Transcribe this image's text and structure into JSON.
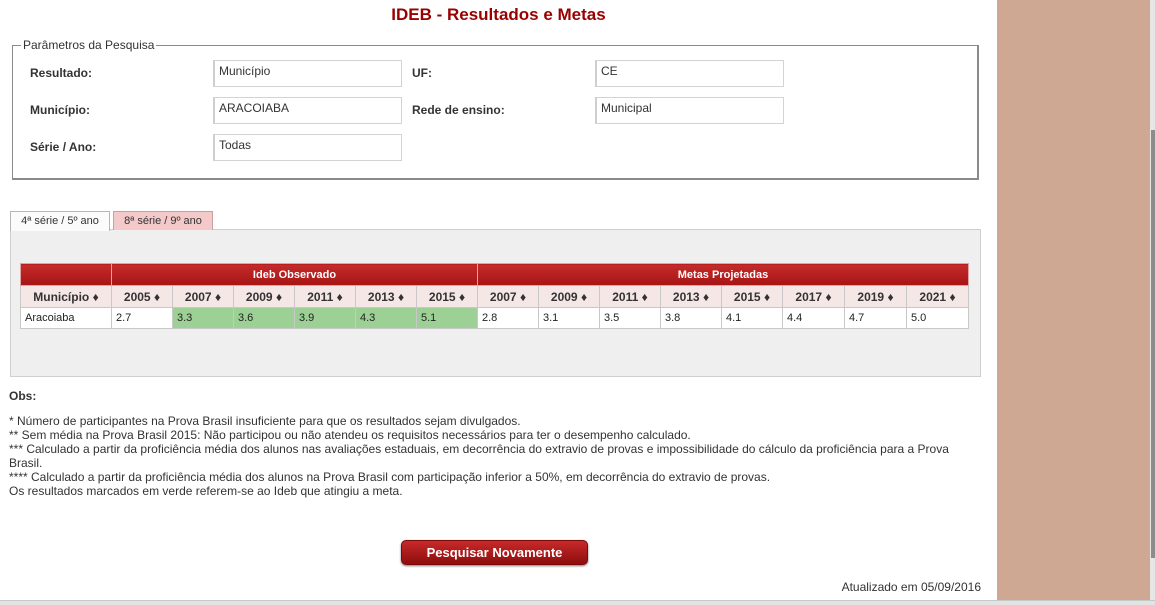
{
  "title": "IDEB - Resultados e Metas",
  "params": {
    "legend": "Parâmetros da Pesquisa",
    "resultado_label": "Resultado:",
    "resultado_value": "Município",
    "uf_label": "UF:",
    "uf_value": "CE",
    "municipio_label": "Município:",
    "municipio_value": "ARACOIABA",
    "rede_label": "Rede de ensino:",
    "rede_value": "Municipal",
    "serie_label": "Série / Ano:",
    "serie_value": "Todas"
  },
  "tabs": [
    {
      "label": "4ª série / 5º ano",
      "active": true
    },
    {
      "label": "8ª série / 9º ano",
      "active": false
    }
  ],
  "table": {
    "group_observado": "Ideb Observado",
    "group_metas": "Metas Projetadas",
    "sort_glyph": "♦",
    "municipio_header": "Município",
    "observado_years": [
      "2005",
      "2007",
      "2009",
      "2011",
      "2013",
      "2015"
    ],
    "metas_years": [
      "2007",
      "2009",
      "2011",
      "2013",
      "2015",
      "2017",
      "2019",
      "2021"
    ],
    "row": {
      "municipio": "Aracoiaba",
      "observado": [
        "2.7",
        "3.3",
        "3.6",
        "3.9",
        "4.3",
        "5.1"
      ],
      "observado_met_goal": [
        false,
        true,
        true,
        true,
        true,
        true
      ],
      "metas": [
        "2.8",
        "3.1",
        "3.5",
        "3.8",
        "4.1",
        "4.4",
        "4.7",
        "5.0"
      ]
    },
    "green_color": "#9dd095"
  },
  "obs": {
    "title": "Obs:",
    "lines": [
      "* Número de participantes na Prova Brasil insuficiente para que os resultados sejam divulgados.",
      "** Sem média na Prova Brasil 2015: Não participou ou não atendeu os requisitos necessários para ter o desempenho calculado.",
      "*** Calculado a partir da proficiência média dos alunos nas avaliações estaduais, em decorrência do extravio de provas e impossibilidade do cálculo da proficiência para a Prova Brasil.",
      "**** Calculado a partir da proficiência média dos alunos na Prova Brasil com participação inferior a 50%, em decorrência do extravio de provas.",
      "Os resultados marcados em verde referem-se ao Ideb que atingiu a meta."
    ]
  },
  "search_again_label": "Pesquisar Novamente",
  "updated": "Atualizado em 05/09/2016",
  "colors": {
    "accent": "#990000",
    "side_panel": "#cfa894"
  }
}
